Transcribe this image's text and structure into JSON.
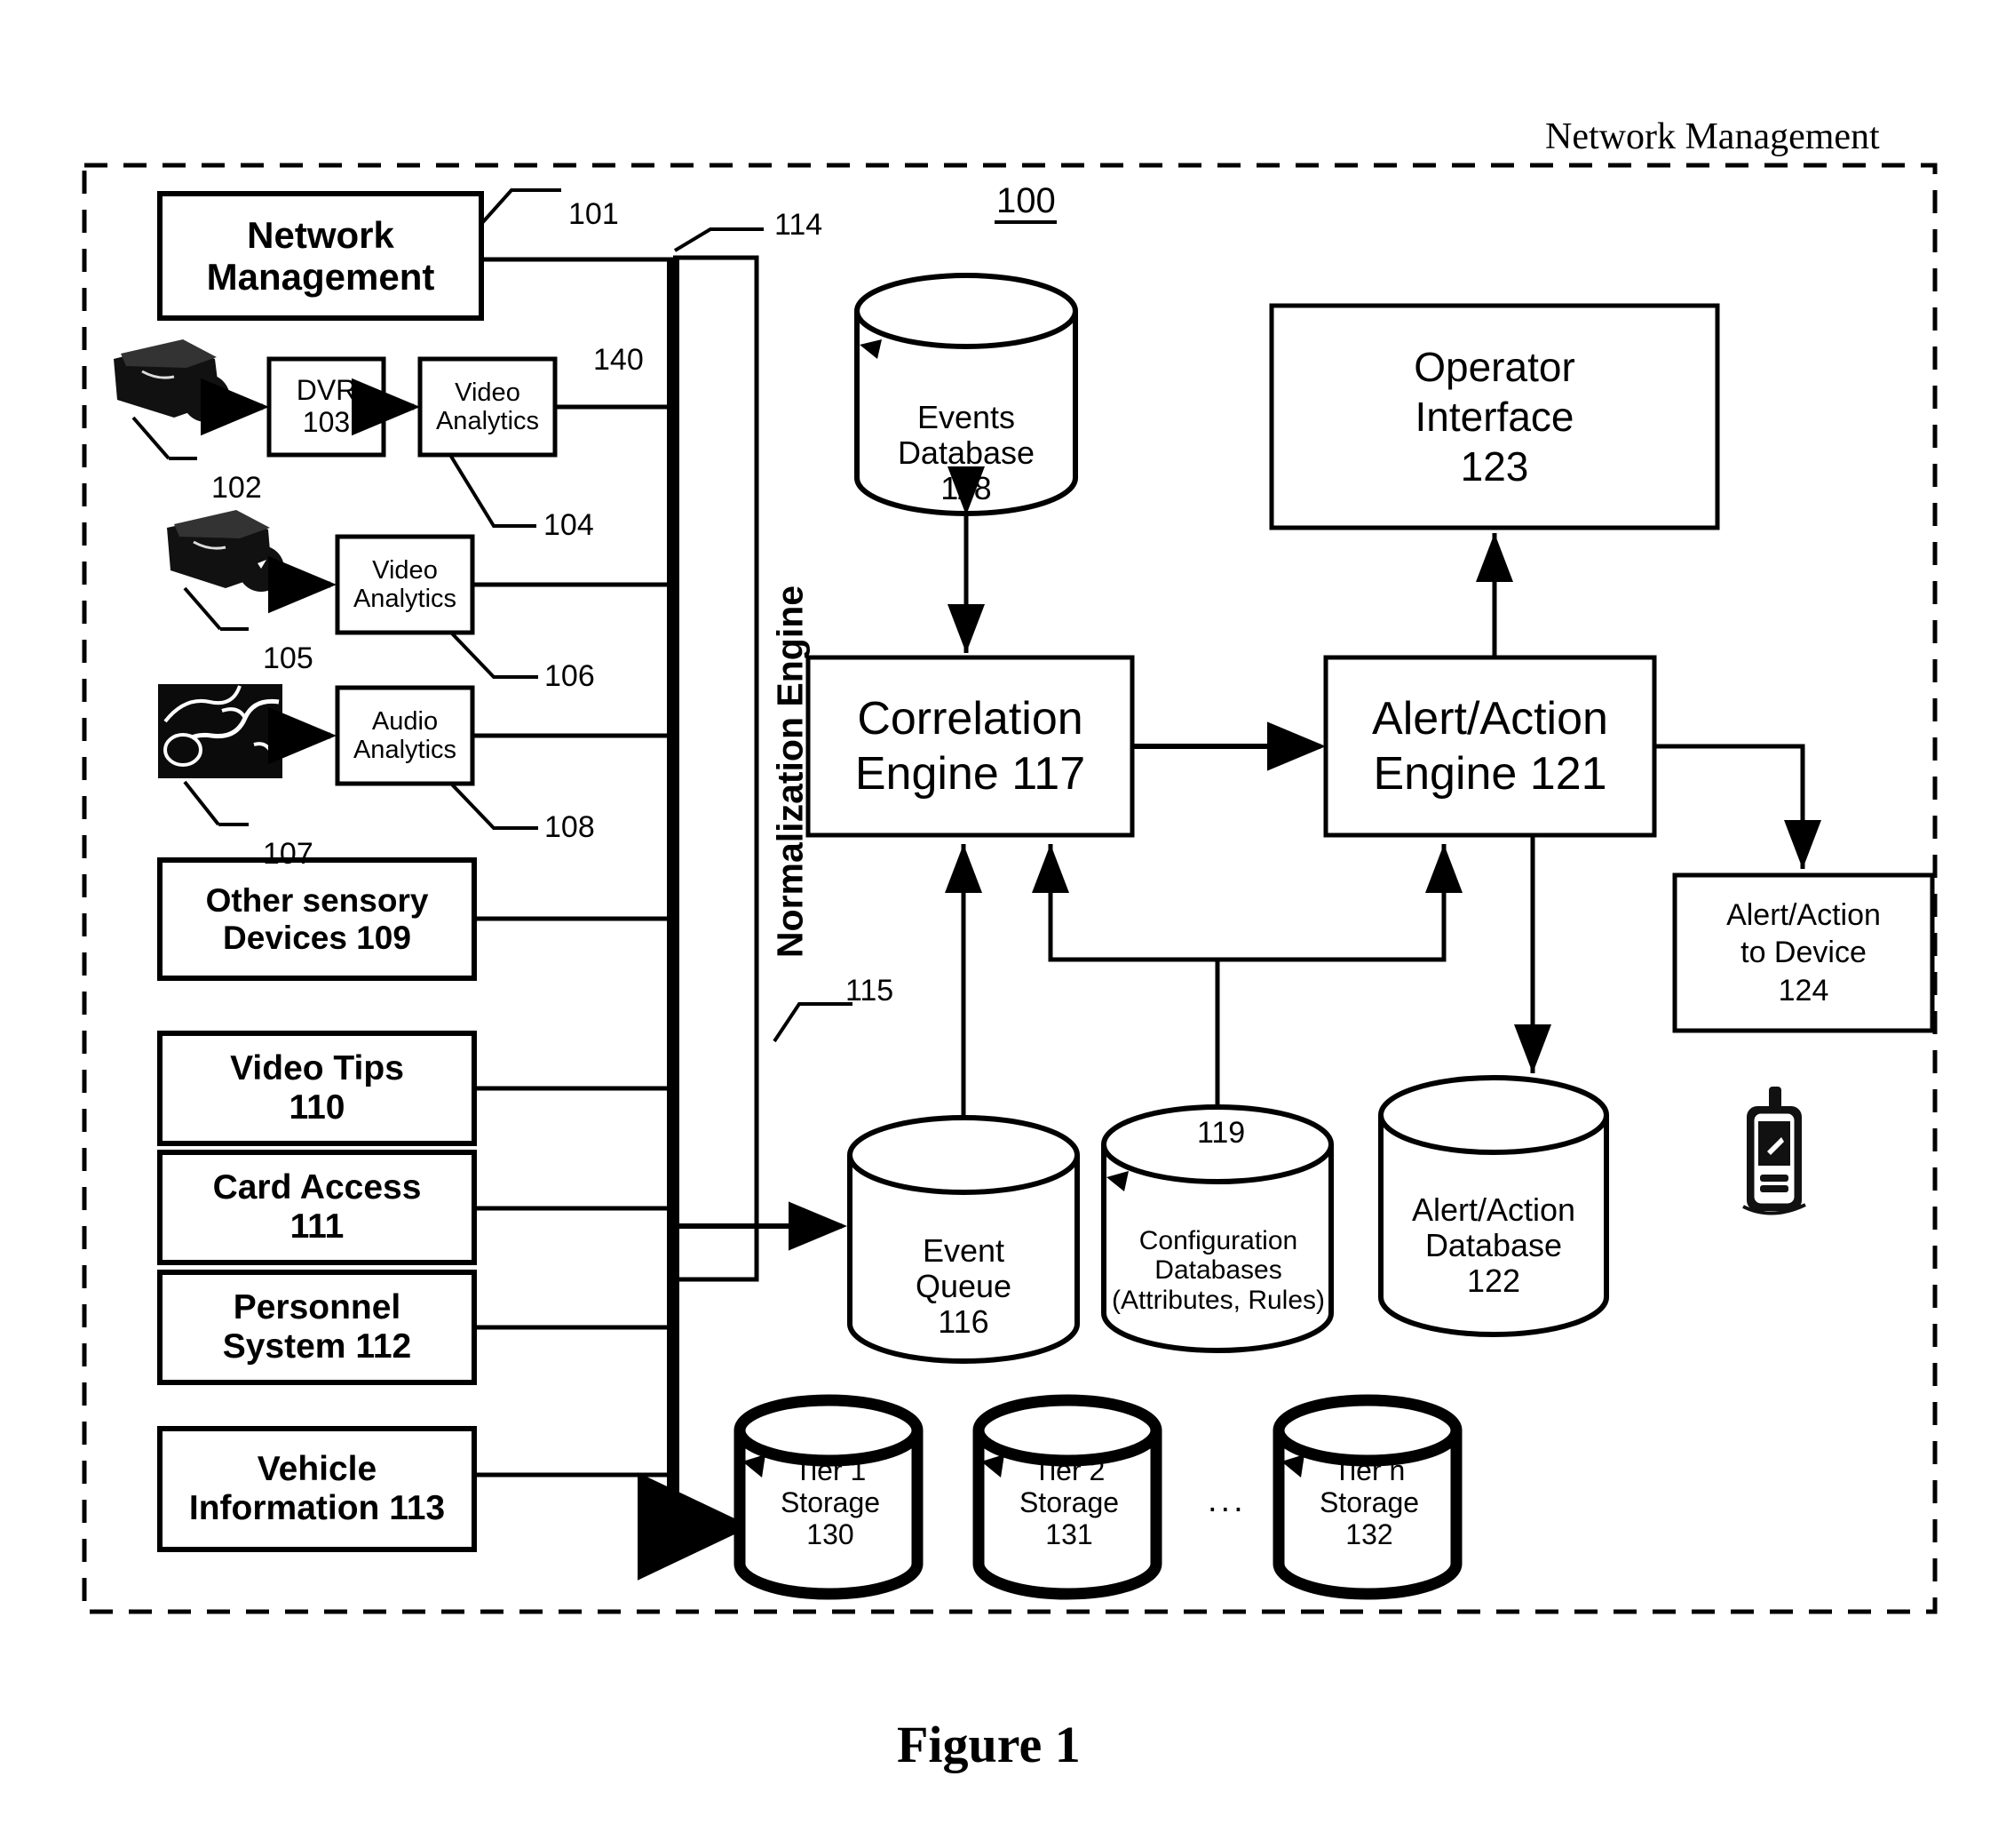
{
  "figure": {
    "caption": "Figure 1",
    "system_ref": "100",
    "outer_label": "Network Management"
  },
  "blocks": {
    "network_management": {
      "line1": "Network",
      "line2": "Management",
      "ref": "101"
    },
    "dvr": {
      "line1": "DVR",
      "line2": "103"
    },
    "video_analytics_1": {
      "line1": "Video",
      "line2": "Analytics",
      "ref": "104"
    },
    "video_analytics_2": {
      "line1": "Video",
      "line2": "Analytics",
      "ref": "106"
    },
    "audio_analytics": {
      "line1": "Audio",
      "line2": "Analytics",
      "ref": "108"
    },
    "other_sensory": {
      "line1": "Other sensory",
      "line2": "Devices 109"
    },
    "video_tips": {
      "line1": "Video Tips",
      "line2": "110"
    },
    "card_access": {
      "line1": "Card Access",
      "line2": "111"
    },
    "personnel_system": {
      "line1": "Personnel",
      "line2": "System 112"
    },
    "vehicle_information": {
      "line1": "Vehicle",
      "line2": "Information 113"
    },
    "normalization_engine": {
      "label": "Normalization Engine",
      "ref": "114"
    },
    "correlation_engine": {
      "line1": "Correlation",
      "line2": "Engine 117"
    },
    "alert_action_engine": {
      "line1": "Alert/Action",
      "line2": "Engine 121"
    },
    "operator_interface": {
      "line1": "Operator",
      "line2": "Interface",
      "line3": "123"
    },
    "alert_action_to_device": {
      "line1": "Alert/Action",
      "line2": "to Device",
      "line3": "124"
    }
  },
  "cylinders": {
    "events_database": {
      "line1": "Events",
      "line2": "Database",
      "line3": "118"
    },
    "event_queue": {
      "line1": "Event",
      "line2": "Queue",
      "line3": "116"
    },
    "configuration_databases": {
      "line1": "Configuration",
      "line2": "Databases",
      "line3": "(Attributes, Rules)",
      "ref": "119"
    },
    "alert_action_database": {
      "line1": "Alert/Action",
      "line2": "Database",
      "line3": "122"
    },
    "tier1_storage": {
      "line1": "Tier 1",
      "line2": "Storage",
      "line3": "130"
    },
    "tier2_storage": {
      "line1": "Tier 2",
      "line2": "Storage",
      "line3": "131"
    },
    "tiern_storage": {
      "line1": "Tier n",
      "line2": "Storage",
      "line3": "132"
    },
    "ellipsis": "..."
  },
  "ref_numerals": {
    "camera_1": "102",
    "camera_2": "105",
    "microphone": "107",
    "bus_feed": "115",
    "analytics_out": "140"
  },
  "icons": {
    "camera_1": "video-camera-icon",
    "camera_2": "video-camera-icon",
    "microphone": "microphone-icon",
    "mobile_device": "mobile-phone-icon"
  },
  "colors": {
    "stroke": "#000000",
    "fill": "#ffffff"
  }
}
